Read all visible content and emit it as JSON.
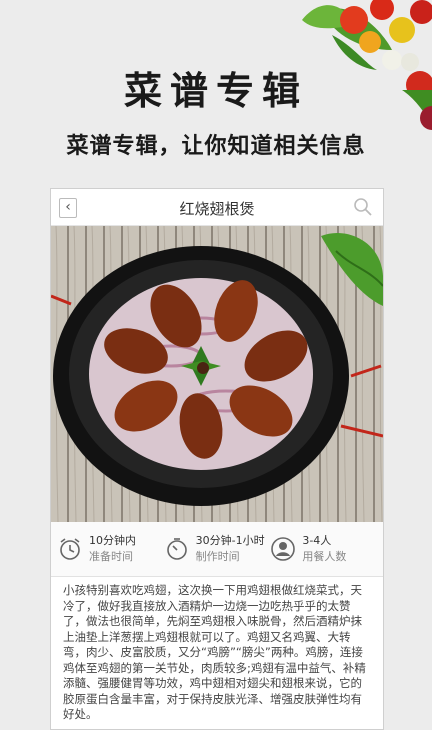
{
  "hero": {
    "title": "菜谱专辑",
    "subtitle": "菜谱专辑，让你知道相关信息"
  },
  "app": {
    "back_label": "‹",
    "title": "红烧翅根煲",
    "search_icon": "search-icon"
  },
  "stats": [
    {
      "icon": "alarm-clock-icon",
      "value": "10分钟内",
      "label": "准备时间"
    },
    {
      "icon": "timer-icon",
      "value": "30分钟-1小时",
      "label": "制作时间"
    },
    {
      "icon": "person-icon",
      "value": "3-4人",
      "label": "用餐人数"
    }
  ],
  "description": "小孩特别喜欢吃鸡翅，这次换一下用鸡翅根做红烧菜式，天冷了，做好我直接放入酒精炉一边烧一边吃热乎乎的太赞了，做法也很简单，先焖至鸡翅根入味脱骨，然后酒精炉抹上油垫上洋葱摆上鸡翅根就可以了。鸡翅又名鸡翼、大转弯，肉少、皮富胶质，又分“鸡膀”“膀尖”两种。鸡膀，连接鸡体至鸡翅的第一关节处，肉质较多;鸡翅有温中益气、补精添髓、强腰健胃等功效，鸡中翅相对翅尖和翅根来说，它的胶原蛋白含量丰富，对于保持皮肤光泽、增强皮肤弹性均有好处。",
  "colors": {
    "background": "#ececec",
    "pot": "#1c1c1c",
    "chicken": "#7a2e12"
  }
}
